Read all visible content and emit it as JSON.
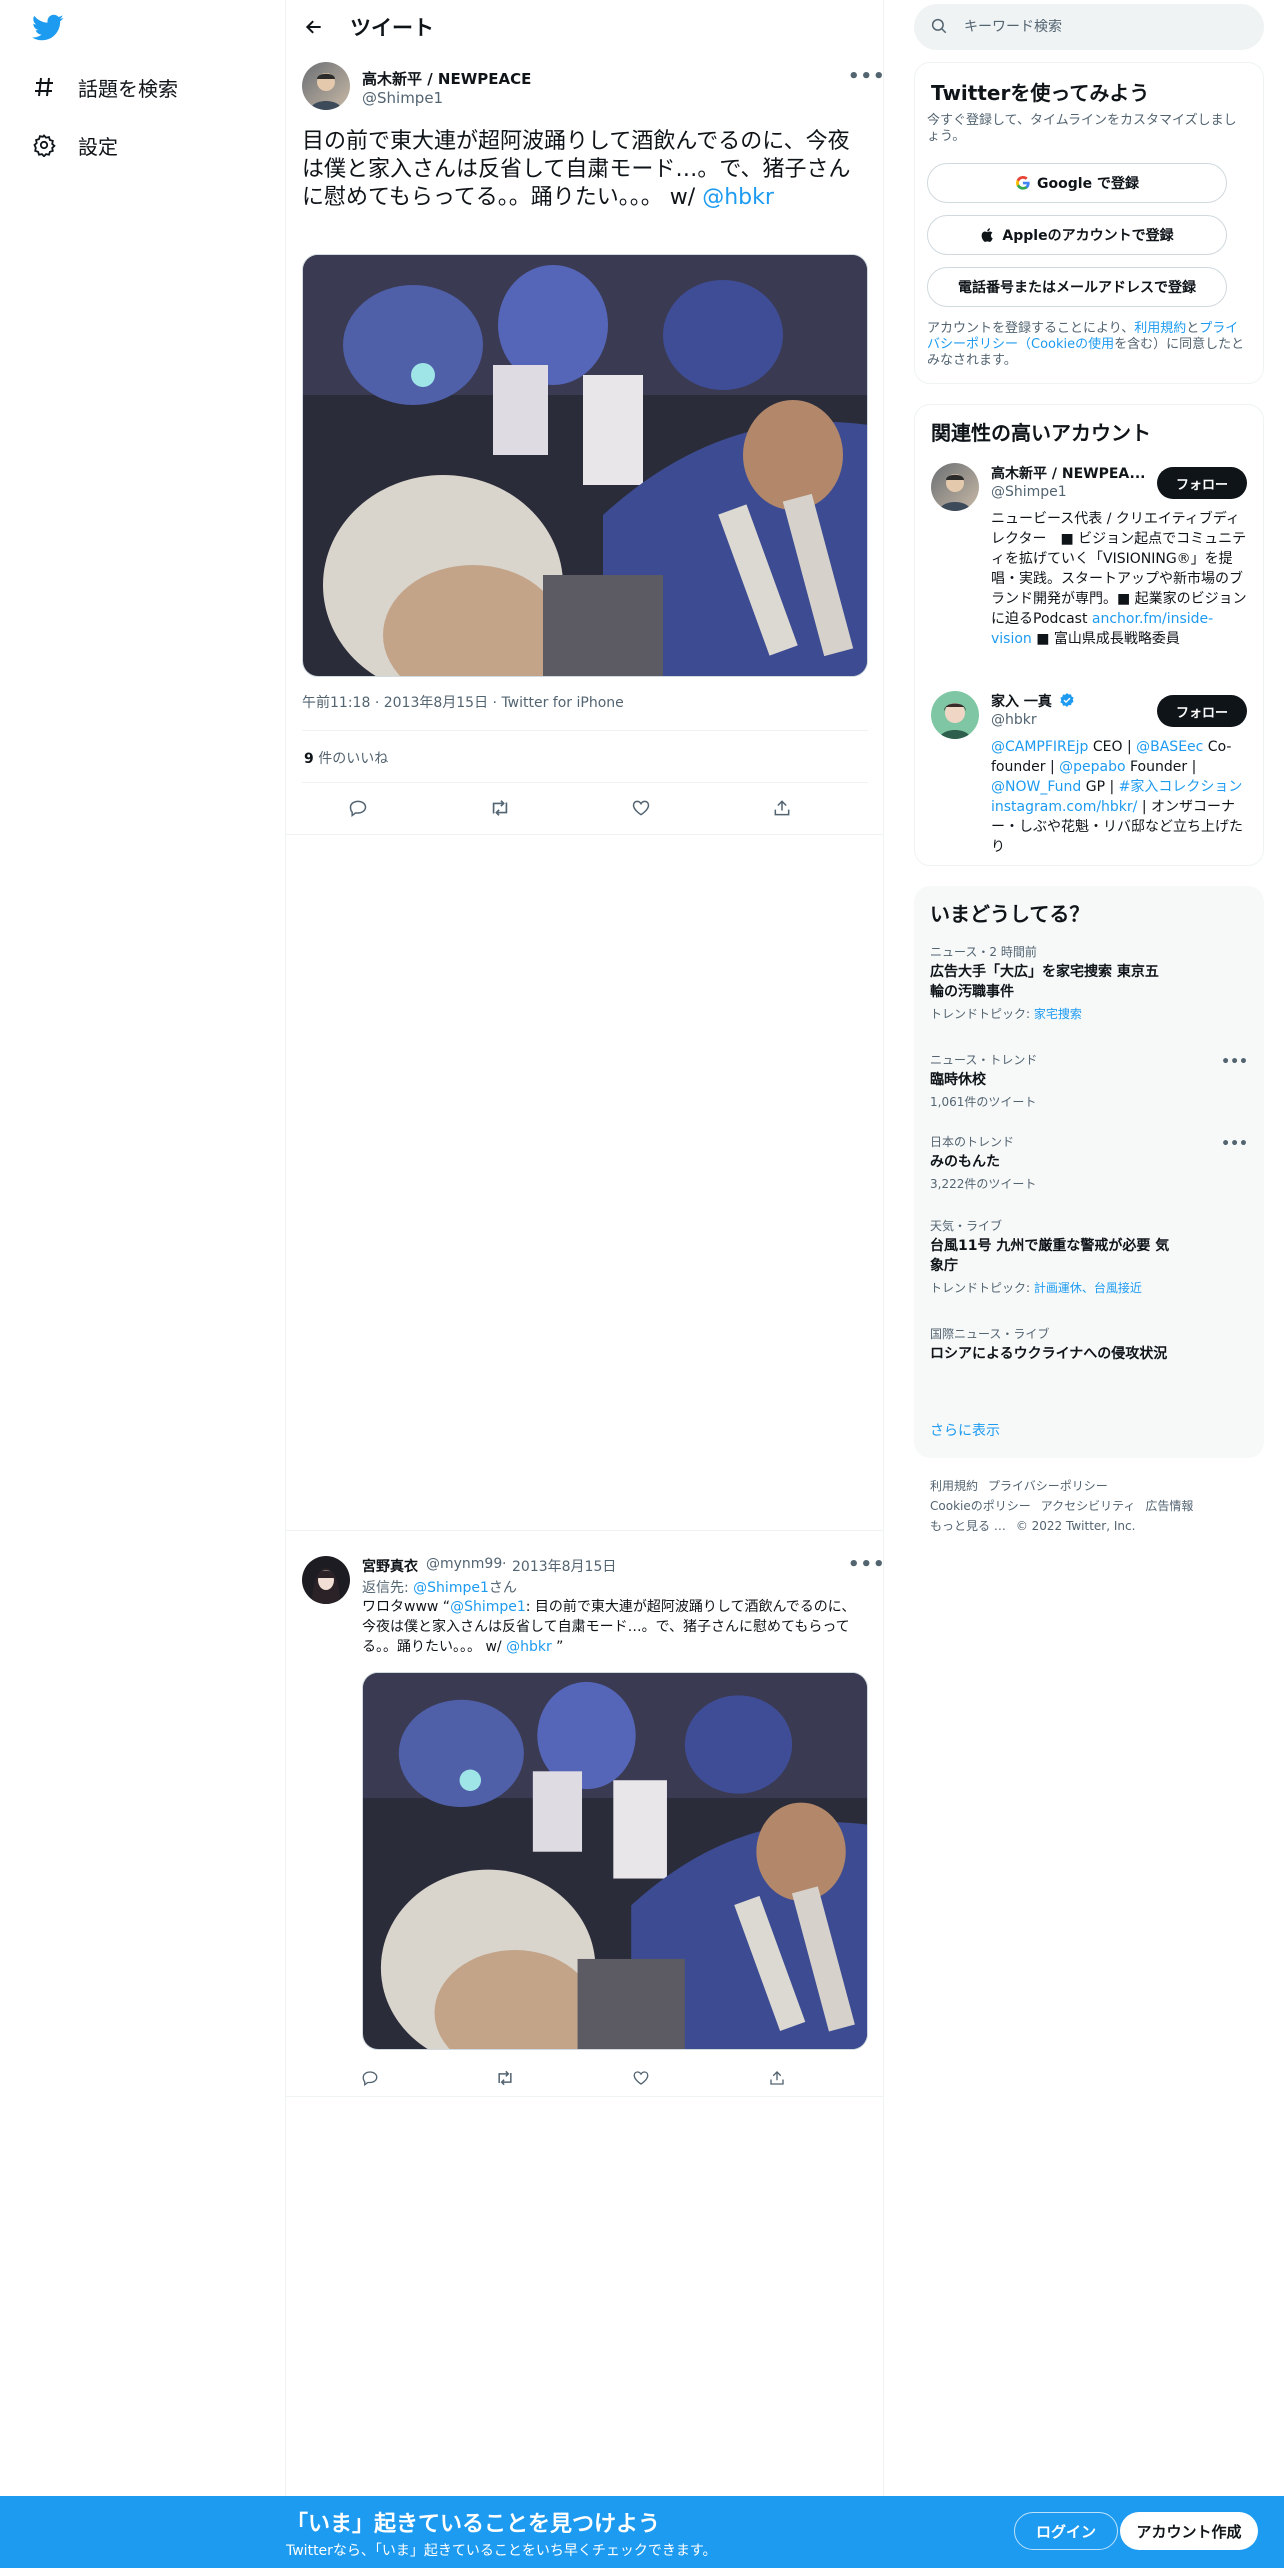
{
  "colors": {
    "accent": "#1d9bf0",
    "text": "#0f1419",
    "muted": "#536471",
    "border": "#eff3f4"
  },
  "nav": {
    "logo_icon": "twitter-bird-icon",
    "items": [
      {
        "icon": "hashtag-icon",
        "label": "話題を検索"
      },
      {
        "icon": "gear-icon",
        "label": "設定"
      }
    ]
  },
  "header": {
    "back_icon": "arrow-left-icon",
    "title": "ツイート"
  },
  "tweet": {
    "author_name": "高木新平 / NEWPEACE",
    "author_handle": "@Shimpe1",
    "more": "•••",
    "text": "目の前で東大連が超阿波踊りして酒飲んでるのに、今夜は僕と家入さんは反省して自粛モード…。で、猪子さんに慰めてもらってる。。踊りたい。。。 w/ ",
    "mention": "@hbkr",
    "time": "午前11:18",
    "date": "2013年8月15日",
    "source": "Twitter for iPhone",
    "likes_count": "9",
    "likes_label": " 件のいいね"
  },
  "reply": {
    "author_name": "宮野真衣",
    "author_handle": "@mynm99",
    "date": "2013年8月15日",
    "more": "•••",
    "reply_to_prefix": "返信先: ",
    "reply_to_handle": "@Shimpe1",
    "reply_to_suffix": "さん",
    "text_pre": "ワロタwww “",
    "mention1": "@Shimpe1",
    "text_mid": ": 目の前で東大連が超阿波踊りして酒飲んでるのに、今夜は僕と家入さんは反省して自粛モード…。で、猪子さんに慰めてもらってる。。踊りたい。。。 w/ ",
    "mention2": "@hbkr",
    "text_post": " ”"
  },
  "search": {
    "placeholder": "キーワード検索"
  },
  "signup_card": {
    "title": "Twitterを使ってみよう",
    "subtitle": "今すぐ登録して、タイムラインをカスタマイズしましょう。",
    "google_label": "Google で登録",
    "apple_label": "Appleのアカウントで登録",
    "phone_label": "電話番号またはメールアドレスで登録",
    "terms_pre": "アカウントを登録することにより、",
    "terms_link": "利用規約",
    "terms_and": "と",
    "privacy_link": "プライバシーポリシー（Cookieの使用",
    "terms_post": "を含む）に同意したとみなされます。"
  },
  "related": {
    "title": "関連性の高いアカウント",
    "accounts": [
      {
        "name": "高木新平 / NEWPEA...",
        "handle": "@Shimpe1",
        "follow": "フォロー",
        "bio": "ニュービース代表 / クリエイティブディレクター　■ ビジョン起点でコミュニティを拡げていく「VISIONING®」を提唱・実践。スタートアップや新市場のブランド開発が専門。■ 起業家のビジョンに迫るPodcast ",
        "bio_link": "anchor.fm/inside-vision",
        "bio_post": " ■ 富山県成長戦略委員"
      },
      {
        "name": "家入 一真",
        "handle": "@hbkr",
        "follow": "フォロー",
        "bio_l1": "@CAMPFIREjp",
        "bio_t1": " CEO | ",
        "bio_l2": "@BASEec",
        "bio_t2": " Co-founder | ",
        "bio_l3": "@pepabo",
        "bio_t3": " Founder | ",
        "bio_l4": "@NOW_Fund",
        "bio_t4": " GP | ",
        "bio_l5": "#家入コレクション",
        "bio_t5": " ",
        "bio_l6": "instagram.com/hbkr/",
        "bio_t6": " | オンザコーナー・しぶや花魁・リバ邸など立ち上げたり"
      }
    ]
  },
  "trends": {
    "title": "いまどうしてる？",
    "items": [
      {
        "category": "ニュース・2 時間前",
        "title": "広告大手「大広」を家宅捜索 東京五輪の汚職事件",
        "sub_prefix": "トレンドトピック: ",
        "sub_link": "家宅捜索"
      },
      {
        "category": "ニュース・トレンド",
        "title": "臨時休校",
        "sub": "1,061件のツイート",
        "more": "•••"
      },
      {
        "category": "日本のトレンド",
        "title": "みのもんた",
        "sub": "3,222件のツイート",
        "more": "•••"
      },
      {
        "category": "天気・ライブ",
        "title": "台風11号 九州で厳重な警戒が必要 気象庁",
        "sub_prefix": "トレンドトピック: ",
        "sub_link": "計画運休、台風接近"
      },
      {
        "category": "国際ニュース・ライブ",
        "title": "ロシアによるウクライナへの侵攻状況"
      }
    ],
    "show_more": "さらに表示"
  },
  "footer": {
    "links": [
      "利用規約",
      "プライバシーポリシー",
      "Cookieのポリシー",
      "アクセシビリティ",
      "広告情報",
      "もっと見る …"
    ],
    "copyright": "© 2022 Twitter, Inc."
  },
  "bottom_bar": {
    "title": "「いま」起きていることを見つけよう",
    "subtitle": "Twitterなら、「いま」起きていることをいち早くチェックできます。",
    "login": "ログイン",
    "signup": "アカウント作成"
  }
}
